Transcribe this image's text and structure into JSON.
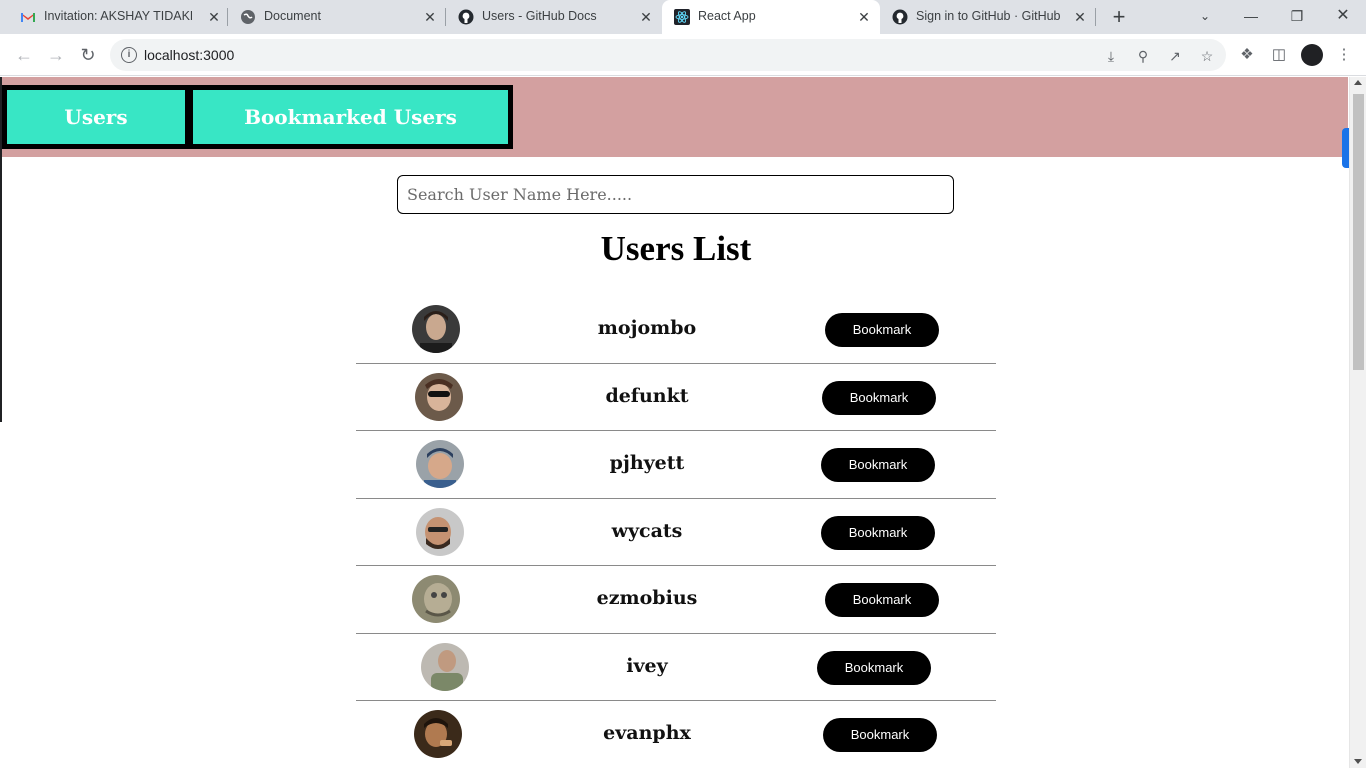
{
  "browser": {
    "tabs": [
      {
        "title": "Invitation: AKSHAY TIDAKE-",
        "icon": "gmail-icon",
        "active": false
      },
      {
        "title": "Document",
        "icon": "globe-icon",
        "active": false
      },
      {
        "title": "Users - GitHub Docs",
        "icon": "github-icon",
        "active": false
      },
      {
        "title": "React App",
        "icon": "react-icon",
        "active": true
      },
      {
        "title": "Sign in to GitHub · GitHub",
        "icon": "github-icon",
        "active": false
      }
    ],
    "url": "localhost:3000"
  },
  "nav": {
    "users_label": "Users",
    "bookmarked_label": "Bookmarked Users"
  },
  "search": {
    "placeholder": "Search User Name Here....."
  },
  "page_title": "Users List",
  "users": [
    {
      "login": "mojombo",
      "action": "Bookmark"
    },
    {
      "login": "defunkt",
      "action": "Bookmark"
    },
    {
      "login": "pjhyett",
      "action": "Bookmark"
    },
    {
      "login": "wycats",
      "action": "Bookmark"
    },
    {
      "login": "ezmobius",
      "action": "Bookmark"
    },
    {
      "login": "ivey",
      "action": "Bookmark"
    },
    {
      "login": "evanphx",
      "action": "Bookmark"
    }
  ],
  "colors": {
    "navbar_bg": "#d3a0a0",
    "nav_button_bg": "#38e6c5",
    "bookmark_bg": "#000000"
  }
}
